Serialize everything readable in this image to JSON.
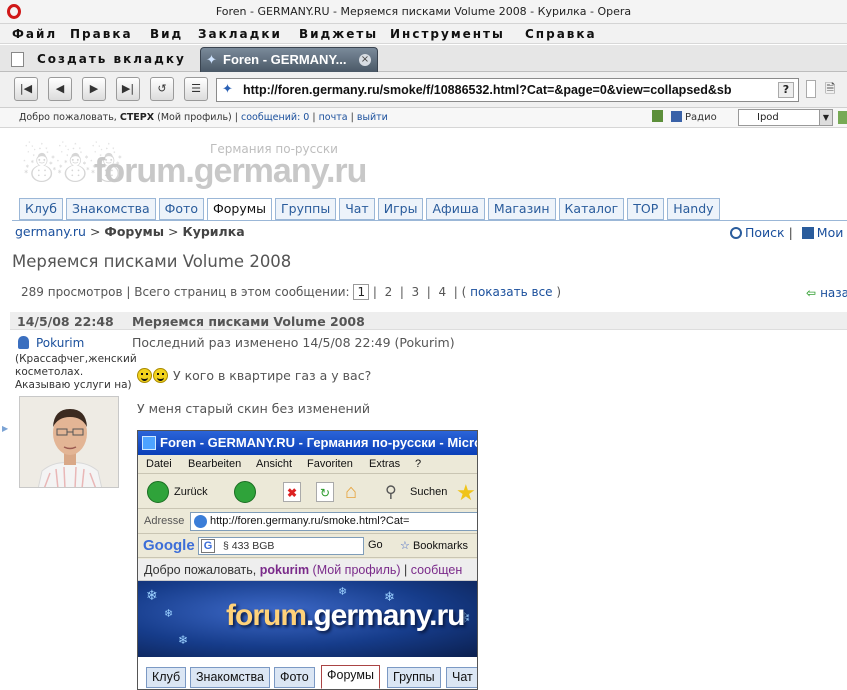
{
  "window": {
    "title": "Foren - GERMANY.RU - Меряемся писками Volume 2008 - Курилка - Opera"
  },
  "menubar": {
    "items": [
      "Файл",
      "Правка",
      "Вид",
      "Закладки",
      "Виджеты",
      "Инструменты",
      "Справка"
    ]
  },
  "tabs": {
    "new_tab_label": "Создать вкладку",
    "active_tab_label": "Foren - GERMANY..."
  },
  "address": {
    "url": "http://foren.germany.ru/smoke/f/10886532.html?Cat=&page=0&view=collapsed&sb"
  },
  "personal_bar": {
    "welcome_prefix": "Добро пожаловать,",
    "username": "СТЕРХ",
    "profile_link": "(Мой профиль)",
    "messages_link": "сообщений: 0",
    "mail_link": "почта",
    "logout_link": "выйти",
    "radio_label": "Радио",
    "ipod_label": "Ipod"
  },
  "site": {
    "logo_text": "forum.germany.ru",
    "logo_subtitle": "Германия по-русски",
    "nav": [
      "Клуб",
      "Знакомства",
      "Фото",
      "Форумы",
      "Группы",
      "Чат",
      "Игры",
      "Афиша",
      "Магазин",
      "Каталог",
      "TOP",
      "Handy"
    ],
    "active_nav": "Форумы"
  },
  "breadcrumb": {
    "home": "germany.ru",
    "forums": "Форумы",
    "section": "Курилка"
  },
  "toplinks": {
    "search": "Поиск",
    "mine": "Мои ф"
  },
  "thread": {
    "title": "Меряемся писками Volume 2008",
    "views": "289 просмотров",
    "pages_label": "Всего страниц в этом сообщении:",
    "pages": [
      "1",
      "2",
      "3",
      "4"
    ],
    "show_all": "показать все",
    "back": "наза"
  },
  "post": {
    "date": "14/5/08 22:48",
    "title": "Меряемся писками Volume 2008",
    "author": "Pokurim",
    "author_description": "(Крассафчег,женский косметолах. Аказываю услуги на)",
    "edited": "Последний раз изменено 14/5/08 22:49 (Pokurim)",
    "line1": "У кого в квартире газ а у вас?",
    "line2": "У меня старый скин без изменений"
  },
  "screenshot": {
    "title": "Foren - GERMANY.RU - Германия по-русски - Micro",
    "menu": [
      "Datei",
      "Bearbeiten",
      "Ansicht",
      "Favoriten",
      "Extras",
      "?"
    ],
    "back_label": "Zurück",
    "search_label": "Suchen",
    "address_label": "Adresse",
    "address_url": "http://foren.germany.ru/smoke.html?Cat=",
    "google_label": "Google",
    "google_field": "§ 433 BGB",
    "go_label": "Go",
    "bookmarks_label": "Bookmarks",
    "welcome_prefix": "Добро пожаловать,",
    "welcome_user": "pokurim",
    "welcome_profile": "(Мой профиль)",
    "welcome_more": "сообщен",
    "banner_logo_a": "forum",
    "banner_logo_b": ".germany.ru",
    "nav": [
      "Клуб",
      "Знакомства",
      "Фото",
      "Форумы",
      "Группы",
      "Чат"
    ]
  }
}
